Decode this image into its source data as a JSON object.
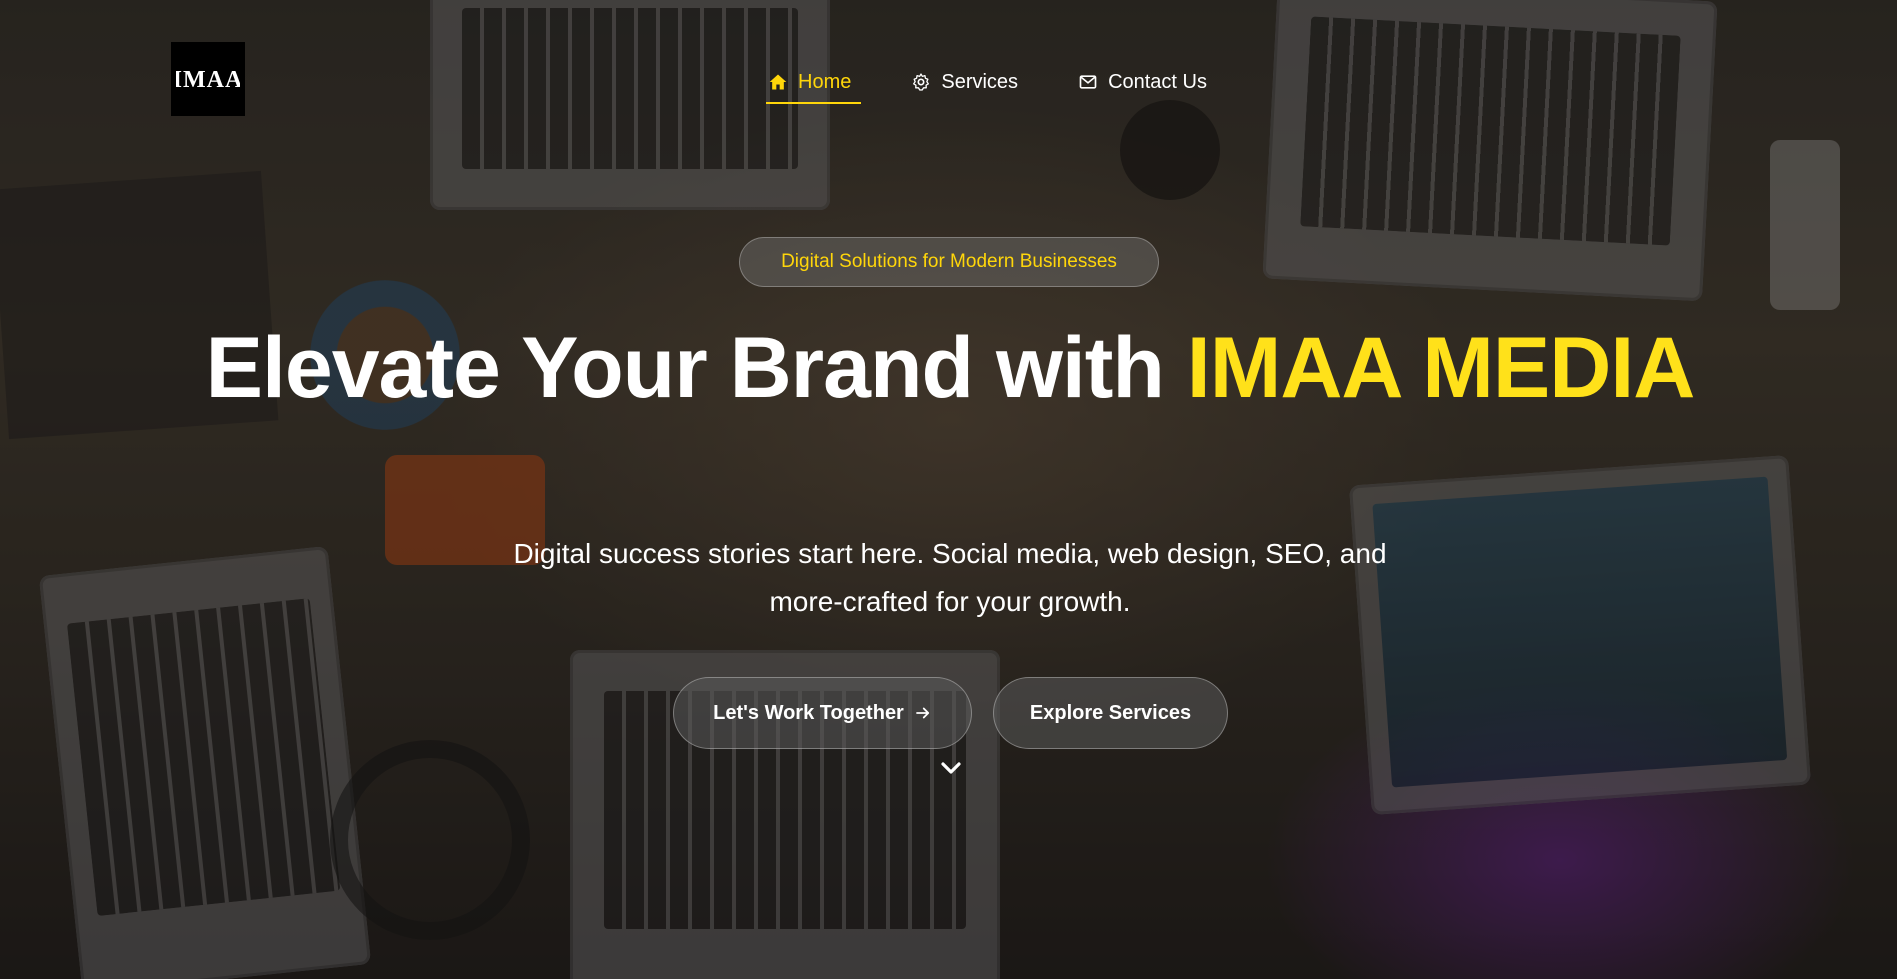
{
  "brand": {
    "logo_text": "IMAA"
  },
  "nav": {
    "items": [
      {
        "label": "Home",
        "icon": "home-icon",
        "active": true
      },
      {
        "label": "Services",
        "icon": "gear-icon",
        "active": false
      },
      {
        "label": "Contact Us",
        "icon": "mail-icon",
        "active": false
      }
    ]
  },
  "hero": {
    "badge": "Digital Solutions for Modern Businesses",
    "headline_part1": "Elevate Your Brand with ",
    "headline_accent": "IMAA MEDIA",
    "subtitle": "Digital success stories start here. Social media, web design, SEO, and more-crafted for your growth.",
    "primary_button": "Let's Work Together",
    "secondary_button": "Explore Services",
    "scroll_icon": "chevron-down-icon"
  },
  "colors": {
    "accent": "#ffd60a",
    "text": "#ffffff"
  }
}
